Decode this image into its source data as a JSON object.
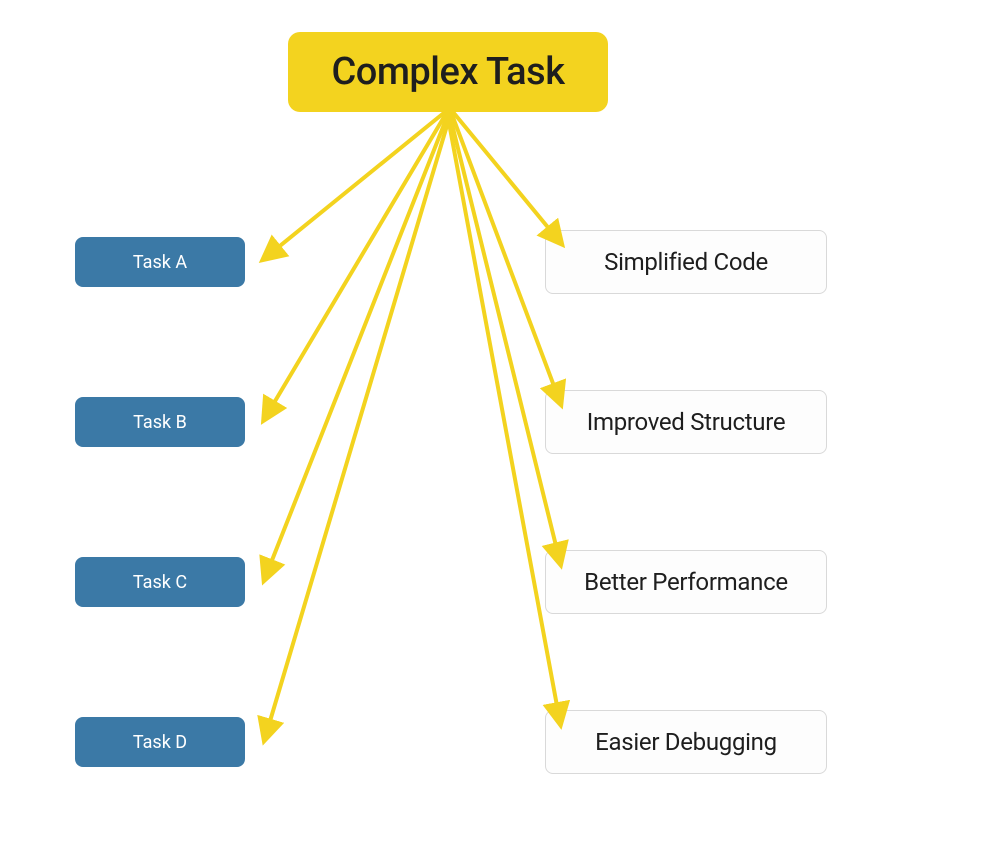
{
  "root": {
    "label": "Complex Task"
  },
  "tasks": [
    {
      "label": "Task A"
    },
    {
      "label": "Task B"
    },
    {
      "label": "Task C"
    },
    {
      "label": "Task D"
    }
  ],
  "benefits": [
    {
      "label": "Simplified Code"
    },
    {
      "label": "Improved Structure"
    },
    {
      "label": "Better Performance"
    },
    {
      "label": "Easier Debugging"
    }
  ],
  "colors": {
    "root_bg": "#f3d31f",
    "task_bg": "#3b79a6",
    "benefit_border": "#d9d9d9",
    "arrow": "#f3d31f"
  }
}
